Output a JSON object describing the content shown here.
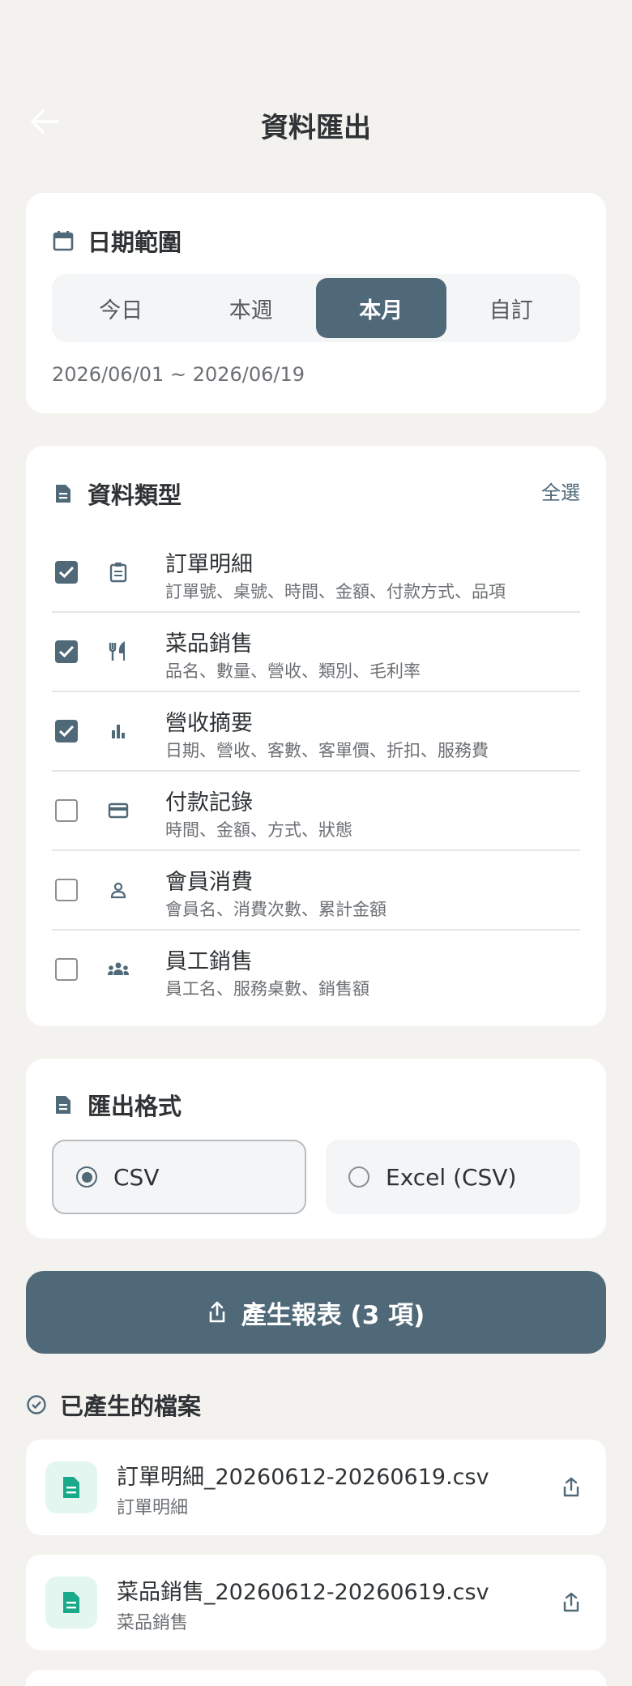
{
  "header": {
    "title": "資料匯出"
  },
  "date_range": {
    "title": "日期範圍",
    "options": [
      "今日",
      "本週",
      "本月",
      "自訂"
    ],
    "selected_index": 2,
    "range_text": "2026/06/01 ~ 2026/06/19"
  },
  "data_types": {
    "title": "資料類型",
    "select_all": "全選",
    "items": [
      {
        "label": "訂單明細",
        "desc": "訂單號、桌號、時間、金額、付款方式、品項",
        "checked": true,
        "icon": "clipboard-icon"
      },
      {
        "label": "菜品銷售",
        "desc": "品名、數量、營收、類別、毛利率",
        "checked": true,
        "icon": "utensils-icon"
      },
      {
        "label": "營收摘要",
        "desc": "日期、營收、客數、客單價、折扣、服務費",
        "checked": true,
        "icon": "bar-chart-icon"
      },
      {
        "label": "付款記錄",
        "desc": "時間、金額、方式、狀態",
        "checked": false,
        "icon": "credit-card-icon"
      },
      {
        "label": "會員消費",
        "desc": "會員名、消費次數、累計金額",
        "checked": false,
        "icon": "person-icon"
      },
      {
        "label": "員工銷售",
        "desc": "員工名、服務桌數、銷售額",
        "checked": false,
        "icon": "group-icon"
      }
    ]
  },
  "export_format": {
    "title": "匯出格式",
    "options": [
      "CSV",
      "Excel (CSV)"
    ],
    "selected_index": 0
  },
  "generate_button": {
    "label": "產生報表 (3 項)"
  },
  "generated_files": {
    "title": "已產生的檔案",
    "files": [
      {
        "name": "訂單明細_20260612-20260619.csv",
        "type": "訂單明細"
      },
      {
        "name": "菜品銷售_20260612-20260619.csv",
        "type": "菜品銷售"
      }
    ]
  },
  "colors": {
    "background": "#f3f2ee",
    "accent": "#506979",
    "file_icon_bg": "#e3f6f0",
    "file_icon_fg": "#1aa989"
  }
}
